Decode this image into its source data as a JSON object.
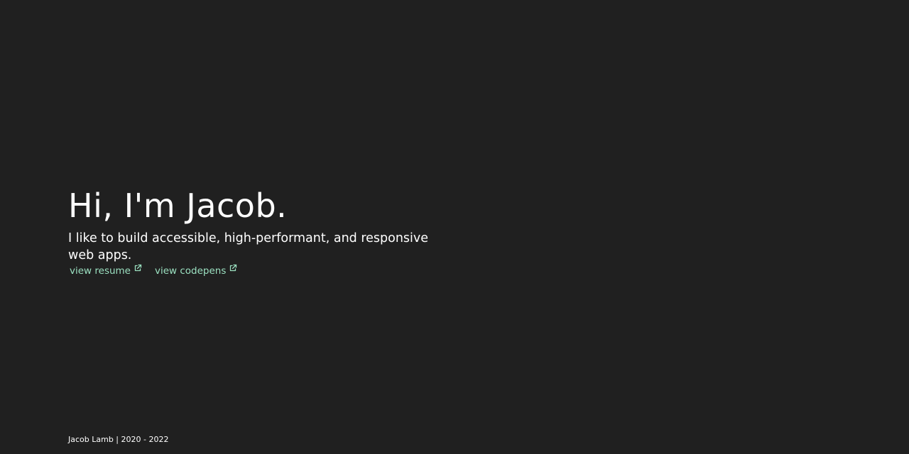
{
  "hero": {
    "title": "Hi, I'm Jacob.",
    "subtitle": "I like to build accessible, high-performant, and responsive web apps."
  },
  "links": [
    {
      "label": "view resume",
      "icon": "external-link-icon"
    },
    {
      "label": "view codepens",
      "icon": "external-link-icon"
    }
  ],
  "footer": {
    "text": "Jacob Lamb | 2020 - 2022"
  },
  "colors": {
    "background": "#202020",
    "text": "#ffffff",
    "accent": "#9be0c0"
  }
}
